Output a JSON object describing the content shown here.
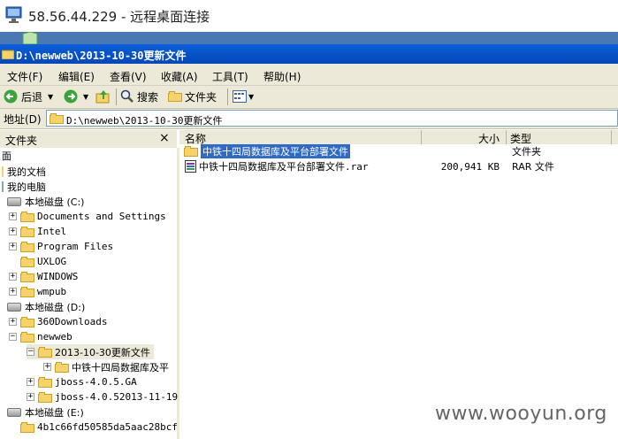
{
  "rdp": {
    "title": "58.56.44.229 - 远程桌面连接"
  },
  "window": {
    "title": "D:\\newweb\\2013-10-30更新文件"
  },
  "menu": [
    "文件(F)",
    "编辑(E)",
    "查看(V)",
    "收藏(A)",
    "工具(T)",
    "帮助(H)"
  ],
  "toolbar": {
    "back": "后退",
    "search": "搜索",
    "folders": "文件夹"
  },
  "address": {
    "label": "地址(D)",
    "value": "D:\\newweb\\2013-10-30更新文件"
  },
  "folders_pane": {
    "title": "文件夹",
    "close": "×"
  },
  "tree": [
    {
      "label": "面",
      "type": "text",
      "pm": ""
    },
    {
      "label": "我的文档",
      "type": "text",
      "pm": ""
    },
    {
      "label": "我的电脑",
      "type": "text",
      "pm": ""
    },
    {
      "label": "本地磁盘 (C:)",
      "type": "drive",
      "pm": ""
    },
    {
      "label": "Documents and Settings",
      "type": "folder",
      "pm": "+"
    },
    {
      "label": "Intel",
      "type": "folder",
      "pm": "+"
    },
    {
      "label": "Program Files",
      "type": "folder",
      "pm": "+"
    },
    {
      "label": "UXLOG",
      "type": "folder",
      "pm": ""
    },
    {
      "label": "WINDOWS",
      "type": "folder",
      "pm": "+"
    },
    {
      "label": "wmpub",
      "type": "folder",
      "pm": "+"
    },
    {
      "label": "本地磁盘 (D:)",
      "type": "drive",
      "pm": ""
    },
    {
      "label": "360Downloads",
      "type": "folder",
      "pm": "+"
    },
    {
      "label": "newweb",
      "type": "folder",
      "pm": "−"
    },
    {
      "label": "2013-10-30更新文件",
      "type": "folder",
      "pm": "−"
    },
    {
      "label": "中铁十四局数据库及平",
      "type": "folder",
      "pm": "+"
    },
    {
      "label": "jboss-4.0.5.GA",
      "type": "folder",
      "pm": "+"
    },
    {
      "label": "jboss-4.0.52013-11-19",
      "type": "folder",
      "pm": "+"
    },
    {
      "label": "本地磁盘 (E:)",
      "type": "drive",
      "pm": ""
    },
    {
      "label": "4b1c66fd50585da5aac28bcf",
      "type": "folder",
      "pm": ""
    }
  ],
  "columns": {
    "name": "名称",
    "size": "大小",
    "type": "类型"
  },
  "files": [
    {
      "name": "中铁十四局数据库及平台部署文件",
      "size": "",
      "type": "文件夹"
    },
    {
      "name": "中铁十四局数据库及平台部署文件.rar",
      "size": "200,941 KB",
      "type": "RAR 文件"
    }
  ],
  "watermark": "www.wooyun.org"
}
